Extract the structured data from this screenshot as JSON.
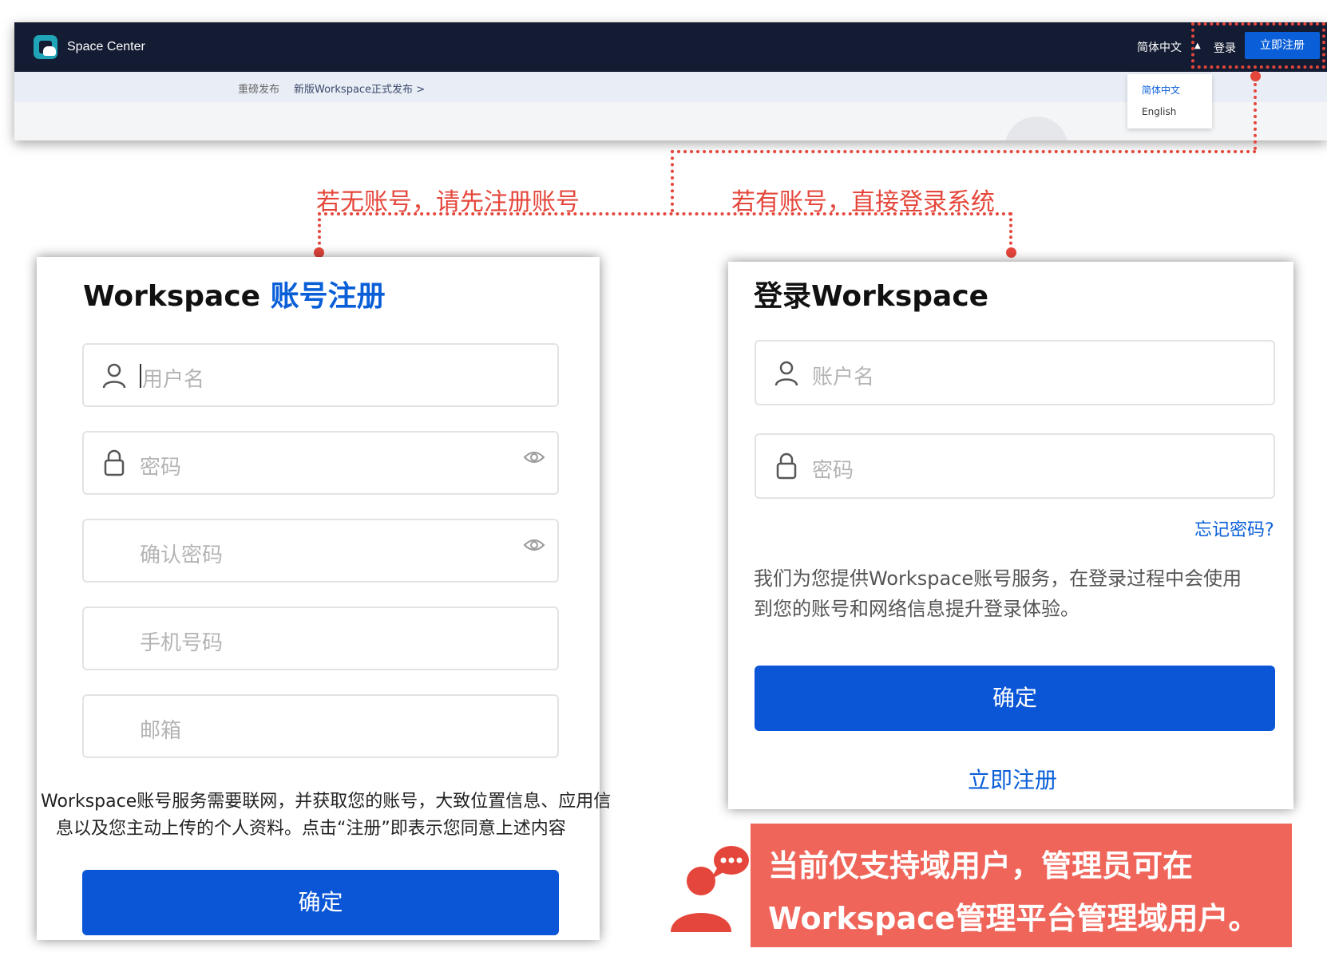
{
  "top": {
    "brand": "Space Center",
    "lang": "简体中文",
    "login": "登录",
    "register": "立即注册",
    "announce_tag": "重磅发布",
    "announce_link": "新版Workspace正式发布 >",
    "lang_options": [
      "简体中文",
      "English"
    ]
  },
  "annotations": {
    "left": "若无账号，请先注册账号",
    "right": "若有账号，直接登录系统"
  },
  "register": {
    "title_prefix": "Workspace ",
    "title_accent": "账号注册",
    "username_ph": "用户名",
    "password_ph": "密码",
    "confirm_ph": "确认密码",
    "phone_ph": "手机号码",
    "email_ph": "邮箱",
    "notice_1": "Workspace账号服务需要联网，并获取您的账号，大致位置信息、应用信",
    "notice_2": "息以及您主动上传的个人资料。点击“注册”即表示您同意上述内容",
    "submit": "确定"
  },
  "login": {
    "title": "登录Workspace",
    "account_ph": "账户名",
    "password_ph": "密码",
    "forgot": "忘记密码?",
    "info_1": "我们为您提供Workspace账号服务，在登录过程中会使用",
    "info_2": "到您的账号和网络信息提升登录体验。",
    "submit": "确定",
    "register_link": "立即注册"
  },
  "callout": {
    "line1": "当前仅支持域用户，管理员可在",
    "line2": "Workspace管理平台管理域用户。"
  },
  "colors": {
    "accent": "#0a5fd8",
    "annotation": "#e5463b",
    "callout_bg": "#f0655a",
    "navbar": "#141c33"
  },
  "icons": [
    "user-icon",
    "lock-icon",
    "eye-icon",
    "chat-bubble-icon",
    "person-icon",
    "caret-up-icon"
  ]
}
